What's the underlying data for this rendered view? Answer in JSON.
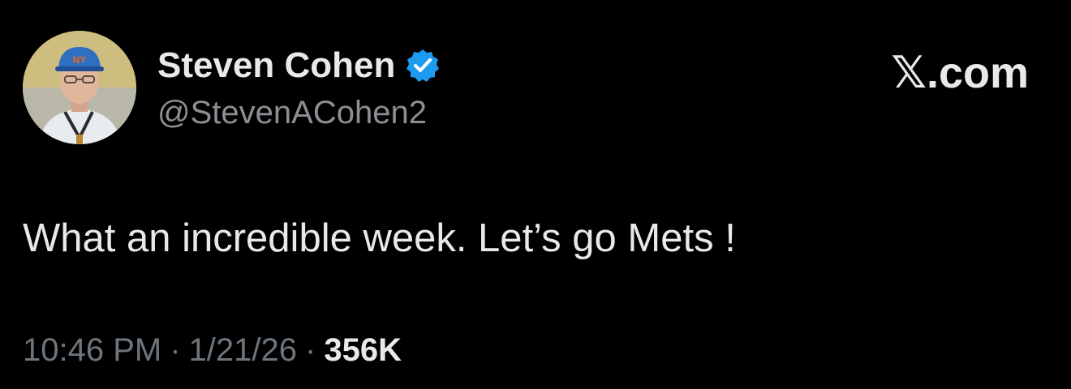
{
  "author": {
    "display_name": "Steven Cohen",
    "handle": "@StevenACohen2",
    "verified": true,
    "verified_icon": "verified-badge-icon",
    "avatar": "profile-photo"
  },
  "brand": {
    "label": "𝕏.com"
  },
  "tweet": {
    "text": "What an incredible week. Let’s go Mets !",
    "time": "10:46 PM",
    "date": "1/21/26",
    "separator": "·",
    "views": "356K"
  },
  "colors": {
    "background": "#000000",
    "primary_text": "#e7e9ea",
    "secondary_text": "#6e767d",
    "verified_blue": "#1d9bf0"
  }
}
